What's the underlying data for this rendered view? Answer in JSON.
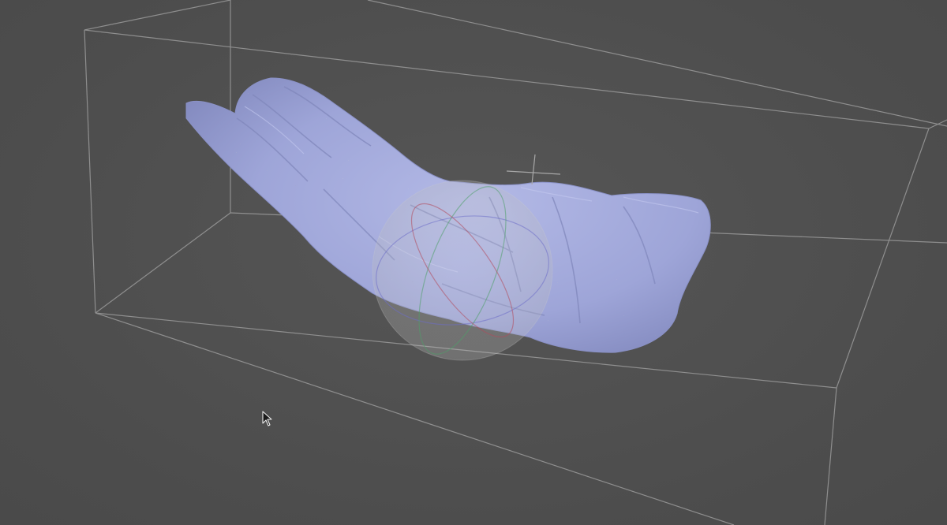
{
  "viewer": {
    "background_color": "#4f4f4f",
    "bounding_box_color": "#9a9a9a",
    "mesh_color": "#9fa6d9",
    "mesh_shadow_color": "#7e85b8",
    "point_color": "#1e1f2a",
    "trackball_color": "#d0d0d0",
    "axis_colors": {
      "x": "#b24a5c",
      "y": "#4fa06a",
      "z": "#6d6dc8"
    },
    "cursor_icon": "arrow-pointer-icon"
  }
}
